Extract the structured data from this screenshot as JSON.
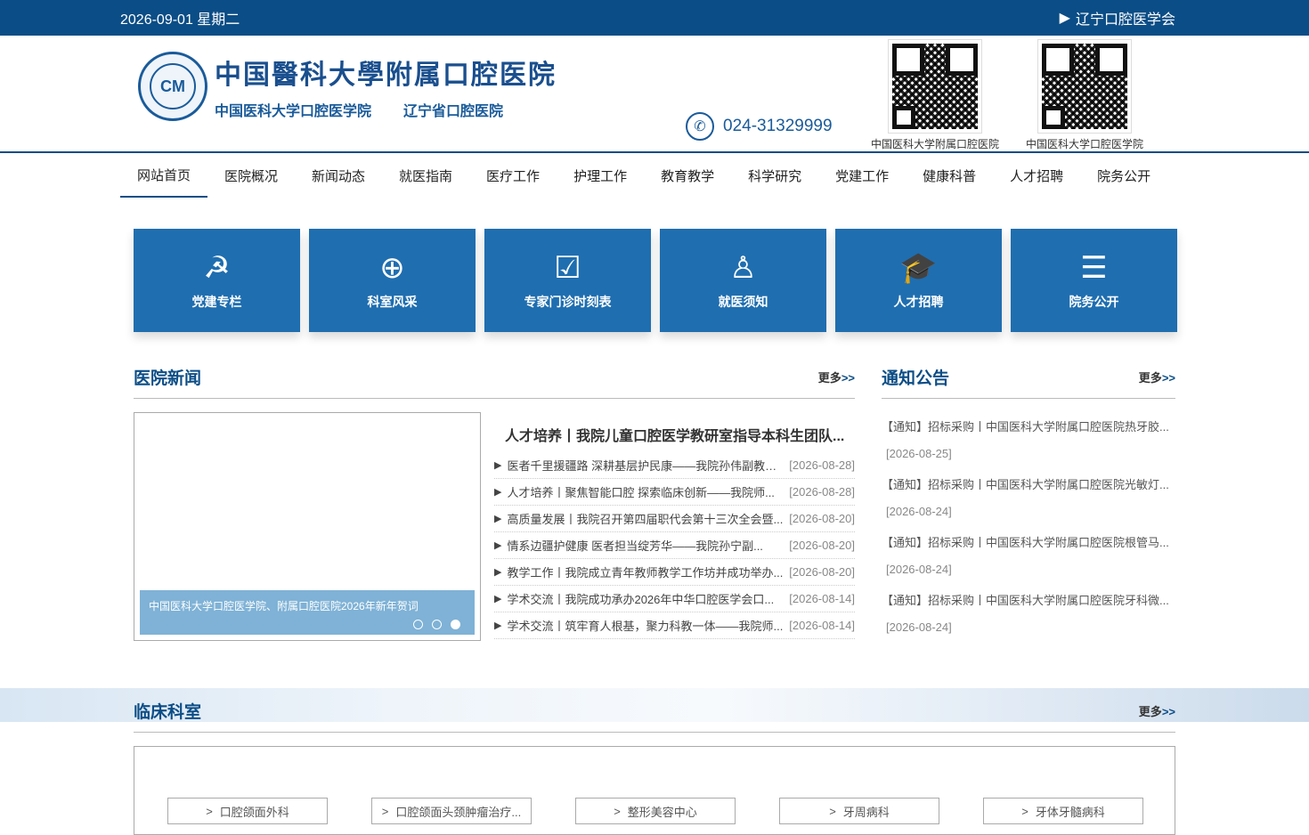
{
  "topbar": {
    "date": "2026-09-01 星期二",
    "society": "辽宁口腔医学会"
  },
  "header": {
    "logo_title": "中国醫科大學附属口腔医院",
    "logo_sub1": "中国医科大学口腔医学院",
    "logo_sub2": "辽宁省口腔医院",
    "phone": "024-31329999",
    "qr1_label": "中国医科大学附属口腔医院",
    "qr2_label": "中国医科大学口腔医学院"
  },
  "nav": [
    "网站首页",
    "医院概况",
    "新闻动态",
    "就医指南",
    "医疗工作",
    "护理工作",
    "教育教学",
    "科学研究",
    "党建工作",
    "健康科普",
    "人才招聘",
    "院务公开"
  ],
  "tiles": [
    {
      "label": "党建专栏",
      "icon": "☭"
    },
    {
      "label": "科室风采",
      "icon": "⊕"
    },
    {
      "label": "专家门诊时刻表",
      "icon": "☑"
    },
    {
      "label": "就医须知",
      "icon": "♙"
    },
    {
      "label": "人才招聘",
      "icon": "🎓"
    },
    {
      "label": "院务公开",
      "icon": "☰"
    }
  ],
  "news": {
    "title": "医院新闻",
    "more": "更多",
    "slider_caption": "中国医科大学口腔医学院、附属口腔医院2026年新年贺词",
    "headline": "人才培养丨我院儿童口腔医学教研室指导本科生团队...",
    "items": [
      {
        "t": "医者千里援疆路 深耕基层护民康——我院孙伟副教授...",
        "d": "[2026-08-28]"
      },
      {
        "t": "人才培养丨聚焦智能口腔 探索临床创新——我院师...",
        "d": "[2026-08-28]"
      },
      {
        "t": "高质量发展丨我院召开第四届职代会第十三次全会暨...",
        "d": "[2026-08-20]"
      },
      {
        "t": "情系边疆护健康 医者担当绽芳华——我院孙宁副...",
        "d": "[2026-08-20]"
      },
      {
        "t": "教学工作丨我院成立青年教师教学工作坊并成功举办...",
        "d": "[2026-08-20]"
      },
      {
        "t": "学术交流丨我院成功承办2026年中华口腔医学会口...",
        "d": "[2026-08-14]"
      },
      {
        "t": "学术交流丨筑牢育人根基，聚力科教一体——我院师...",
        "d": "[2026-08-14]"
      }
    ]
  },
  "notice": {
    "title": "通知公告",
    "more": "更多",
    "items": [
      {
        "t": "【通知】招标采购丨中国医科大学附属口腔医院热牙胶...",
        "d": "[2026-08-25]"
      },
      {
        "t": "【通知】招标采购丨中国医科大学附属口腔医院光敏灯...",
        "d": "[2026-08-24]"
      },
      {
        "t": "【通知】招标采购丨中国医科大学附属口腔医院根管马...",
        "d": "[2026-08-24]"
      },
      {
        "t": "【通知】招标采购丨中国医科大学附属口腔医院牙科微...",
        "d": "[2026-08-24]"
      }
    ]
  },
  "clinic": {
    "title": "临床科室",
    "more": "更多",
    "depts": [
      "口腔颌面外科",
      "口腔颌面头颈肿瘤治疗...",
      "整形美容中心",
      "牙周病科",
      "牙体牙髓病科"
    ]
  },
  "colors": {
    "brand": "#0b4d86",
    "tile": "#1f6eb0"
  }
}
